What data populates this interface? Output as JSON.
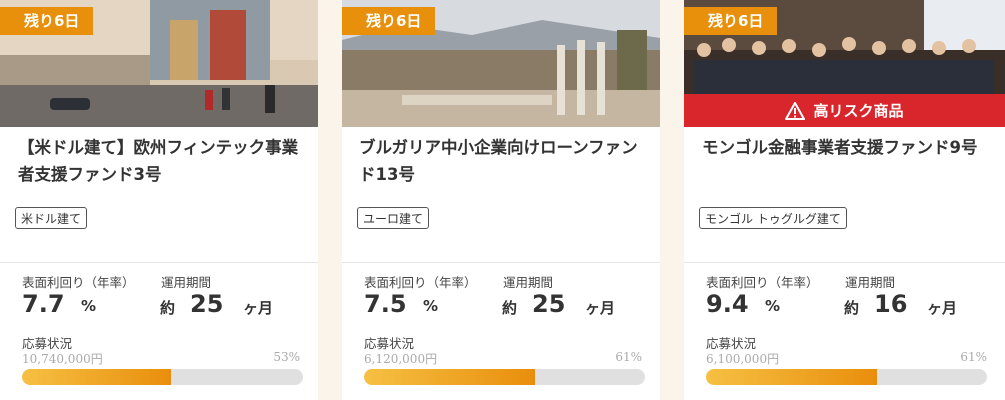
{
  "accent_color": "#e8900c",
  "risk_color": "#d8262c",
  "labels": {
    "yield": "表面利回り（年率）",
    "period": "運用期間",
    "status": "応募状況",
    "percent_unit": "%",
    "approx": "約",
    "months": "ヶ月"
  },
  "cards": [
    {
      "days_left": "残り6日",
      "title": "【米ドル建て】欧州フィンテック事業者支援ファンド3号",
      "currency": "米ドル建て",
      "yield": "7.7",
      "period": "25",
      "amount": "10,740,000円",
      "percent": "53%",
      "progress": 0.53
    },
    {
      "days_left": "残り6日",
      "title": "ブルガリア中小企業向けローンファンド13号",
      "currency": "ユーロ建て",
      "yield": "7.5",
      "period": "25",
      "amount": "6,120,000円",
      "percent": "61%",
      "progress": 0.61
    },
    {
      "days_left": "残り6日",
      "risk_label": "高リスク商品",
      "title": "モンゴル金融事業者支援ファンド9号",
      "currency": "モンゴル トゥグルグ建て",
      "yield": "9.4",
      "period": "16",
      "amount": "6,100,000円",
      "percent": "61%",
      "progress": 0.61
    }
  ]
}
